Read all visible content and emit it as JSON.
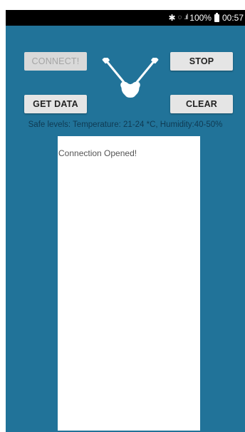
{
  "status_bar": {
    "bluetooth_icon": "bluetooth-icon",
    "wifi_icon": "wifi-icon",
    "signal_icon": "signal-icon",
    "battery_percent": "100%",
    "battery_icon": "battery-icon",
    "time": "00:57"
  },
  "controls": {
    "connect_label": "CONNECT!",
    "stop_label": "STOP",
    "get_data_label": "GET DATA",
    "clear_label": "CLEAR"
  },
  "logo": {
    "icon": "guitars-icon"
  },
  "safe_levels_text": "Safe levels: Temperature: 21-24 *C, Humidity:40-50%",
  "log": {
    "message": "Connection Opened!"
  },
  "colors": {
    "background": "#217399",
    "status_bar": "#000000",
    "button": "#e5e5e5",
    "button_disabled_text": "#a5a5a5",
    "log_panel": "#ffffff"
  }
}
